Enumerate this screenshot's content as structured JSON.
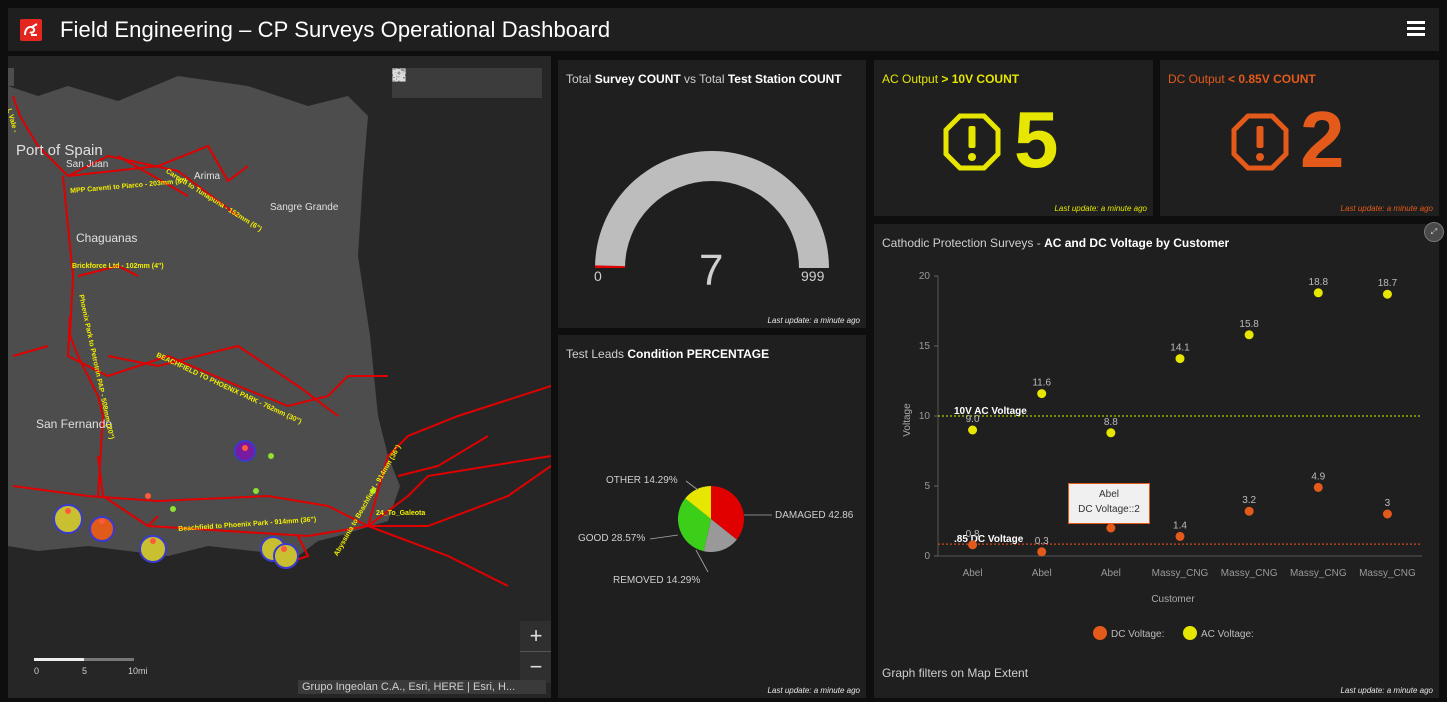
{
  "header": {
    "title": "Field Engineering – CP Surveys Operational Dashboard"
  },
  "map": {
    "tools": [
      "search-icon",
      "home-icon",
      "legend-icon",
      "layers-icon",
      "basemap-icon"
    ],
    "places": {
      "port_of_spain": "Port of Spain",
      "san_juan": "San Juan",
      "arima": "Arima",
      "sangre_grande": "Sangre Grande",
      "chaguanas": "Chaguanas",
      "san_fernando": "San Fernando",
      "l_vale": "L Vale -"
    },
    "pipelines": {
      "p1": "MPP Carenti to Piarco - 203mm (8\")",
      "p2": "Carenti to Tunapuna - 152mm (6\")",
      "p3": "Brickforce Ltd - 102mm (4\")",
      "p4": "Phoenix Park to Petrotrin PAP - 508mm (20\")",
      "p5": "BEACHFIELD TO PHOENIX PARK - 762mm (30\")",
      "p6": "Beachfield to Phoenix Park - 914mm (36\")",
      "p7": "Abyssinia to Beachfield - 914mm (36\")",
      "p8": "24_To_Galeota"
    },
    "zoom_in": "+",
    "zoom_out": "−",
    "attribution": "Grupo Ingeolan C.A., Esri, HERE | Esri, H...",
    "scale": {
      "l0": "0",
      "l1": "5",
      "l2": "10mi"
    }
  },
  "gauge": {
    "title_pre": "Total ",
    "title_b1": "Survey COUNT",
    "title_mid": " vs Total ",
    "title_b2": "Test Station COUNT",
    "value": "7",
    "min": "0",
    "max": "999",
    "value_num": 7,
    "max_num": 999,
    "updated": "Last update: a minute ago"
  },
  "kpi_ac": {
    "title_pre": "AC Output ",
    "title_b": "> 10V COUNT",
    "value": "5",
    "color": "#e6e600",
    "updated": "Last update: a minute ago"
  },
  "kpi_dc": {
    "title_pre": "DC Output ",
    "title_b": "< 0.85V COUNT",
    "value": "2",
    "color": "#e35a1a",
    "updated": "Last update: a minute ago"
  },
  "pie": {
    "title_pre": "Test Leads ",
    "title_b": "Condition PERCENTAGE",
    "labels": {
      "damaged": "DAMAGED 42.86",
      "removed": "REMOVED 14.29%",
      "good": "GOOD 28.57%",
      "other": "OTHER 14.29%"
    },
    "updated": "Last update: a minute ago"
  },
  "chart_data": {
    "type": "scatter",
    "title_pre": "Cathodic Protection Surveys - ",
    "title_b": "AC and DC Voltage by Customer",
    "categories": [
      "Abel",
      "Abel",
      "Abel",
      "Massy_CNG",
      "Massy_CNG",
      "Massy_CNG",
      "Massy_CNG"
    ],
    "series": [
      {
        "name": "DC Voltage:",
        "color": "#e35a1a",
        "values": [
          0.8,
          0.3,
          2,
          1.4,
          3.2,
          4.9,
          3
        ],
        "labels": [
          "0.8",
          "0.3",
          "",
          "1.4",
          "3.2",
          "4.9",
          "3"
        ]
      },
      {
        "name": "AC Voltage:",
        "color": "#e6e600",
        "values": [
          9,
          11.6,
          8.8,
          14.1,
          15.8,
          18.8,
          18.7
        ],
        "labels": [
          "9.0",
          "11.6",
          "8.8",
          "14.1",
          "15.8",
          "18.8",
          "18.7"
        ]
      }
    ],
    "ylabel": "Voltage",
    "xlabel": "Customer",
    "ylim": [
      0,
      20
    ],
    "yticks": [
      "0",
      "5",
      "10",
      "15",
      "20"
    ],
    "ref_lines": [
      {
        "label": "10V AC Voltage",
        "value": 10,
        "color": "#b8c800"
      },
      {
        "label": ".85 DC Voltage",
        "value": 0.85,
        "color": "#d04a1a"
      }
    ],
    "tooltip": {
      "line1": "Abel",
      "line2": "DC Voltage::2"
    },
    "legend_position": "bottom",
    "footer": "Graph filters on Map Extent",
    "updated": "Last update: a minute ago"
  }
}
